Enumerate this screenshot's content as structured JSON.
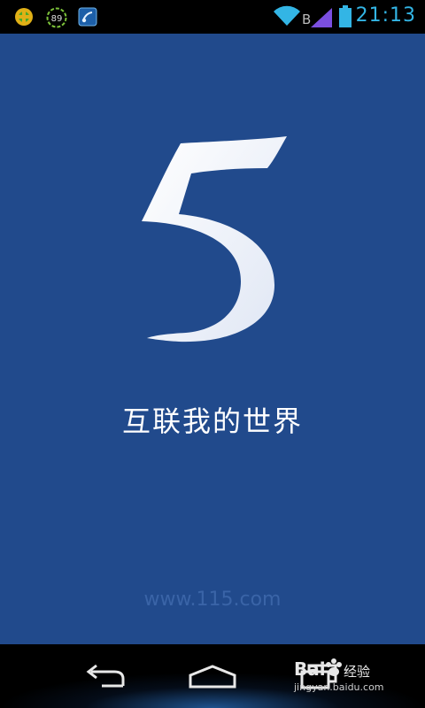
{
  "status_bar": {
    "time": "21:13",
    "notifications": [
      {
        "icon": "puzzle-app-icon"
      },
      {
        "icon": "score-89-icon",
        "label": "89"
      },
      {
        "icon": "music-app-icon"
      }
    ],
    "network_letter": "B",
    "wifi_icon": "wifi-icon",
    "signal_icon": "signal-strength-icon",
    "battery_icon": "battery-icon",
    "accent_color": "#33b5e5"
  },
  "splash": {
    "logo_glyph": "5",
    "tagline": "互联我的世界",
    "site_url": "www.115.com",
    "background_color": "#214a8c"
  },
  "nav_bar": {
    "back_icon": "back-arrow-icon",
    "home_icon": "home-icon",
    "recent_icon": "recent-apps-icon"
  },
  "watermark": {
    "brand": "Bai",
    "suffix": "经验",
    "url": "jingyan.baidu.com"
  }
}
